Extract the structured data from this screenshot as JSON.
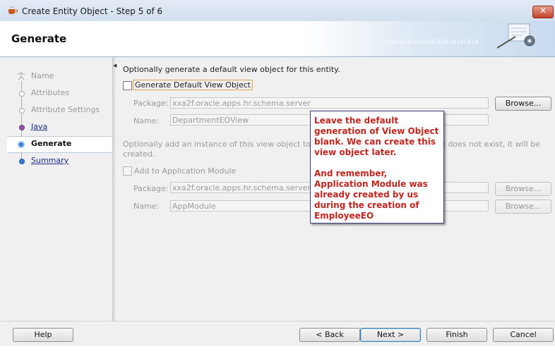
{
  "window": {
    "title": "Create Entity Object - Step 5 of 6",
    "close_icon": "close-icon"
  },
  "header": {
    "title": "Generate",
    "binary_text": "0101010101010101010101010"
  },
  "steps": [
    {
      "label": "Name",
      "state": "disabled"
    },
    {
      "label": "Attributes",
      "state": "disabled"
    },
    {
      "label": "Attribute Settings",
      "state": "disabled"
    },
    {
      "label": "Java",
      "state": "visited"
    },
    {
      "label": "Generate",
      "state": "current"
    },
    {
      "label": "Summary",
      "state": "link"
    }
  ],
  "main": {
    "intro": "Optionally generate a default view object for this entity.",
    "view_object": {
      "checkbox_label": "Generate Default View Object",
      "checked": false,
      "package_label": "Package:",
      "package_value": "xxa2f.oracle.apps.hr.schema.server",
      "name_label": "Name:",
      "name_value": "DepartmentEOView",
      "browse_label": "Browse..."
    },
    "app_module": {
      "intro_left": "Optionally add an instance of this view object to an app",
      "intro_right": "le does not exist, it will be",
      "intro_line2": "created.",
      "checkbox_label": "Add to Application Module",
      "checked": false,
      "package_label": "Package:",
      "package_value": "xxa2f.oracle.apps.hr.schema.server",
      "name_label": "Name:",
      "name_value": "AppModule",
      "browse_label": "Browse..."
    }
  },
  "callout": {
    "paragraph1": "Leave the default generation of View Object blank. We can create this view object later.",
    "paragraph2": "And remember, Application Module was already created by us during the creation of EmployeeEO"
  },
  "footer": {
    "help": "Help",
    "back": "< Back",
    "next": "Next >",
    "finish": "Finish",
    "cancel": "Cancel"
  },
  "colors": {
    "callout_text": "#c0261e",
    "step_link": "#1a2a8a",
    "title_bar": "#d2dfee"
  }
}
